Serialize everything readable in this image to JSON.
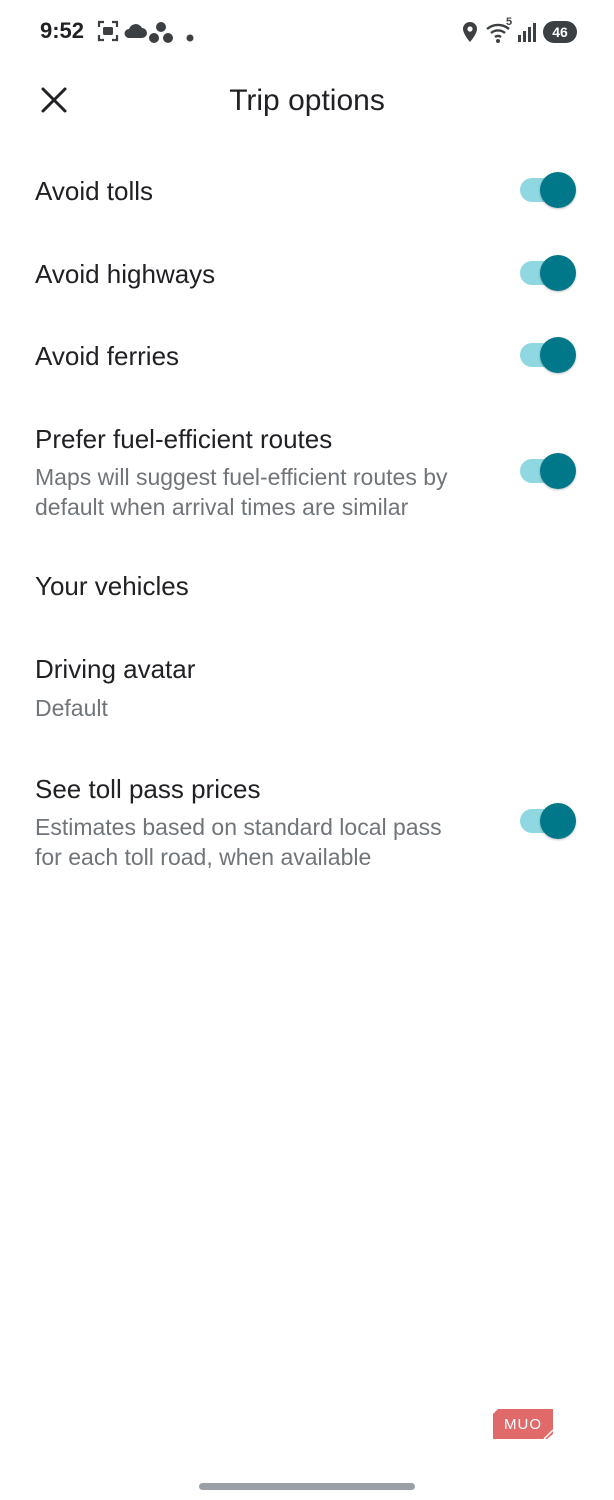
{
  "status_bar": {
    "time": "9:52",
    "icons": [
      "screenshot-icon",
      "cloud-icon",
      "cluster-icon",
      "dot-icon",
      "location-icon",
      "wifi-icon",
      "signal-icon"
    ],
    "wifi_badge": "5",
    "battery_level": "46"
  },
  "header": {
    "title": "Trip options",
    "close_icon": "close-icon"
  },
  "colors": {
    "toggle_thumb": "#00788a",
    "toggle_track": "#8fd7e1",
    "primary_text": "#202124",
    "secondary_text": "#70757a",
    "watermark": "#e06a6a"
  },
  "options": {
    "avoid_tolls": {
      "label": "Avoid tolls",
      "enabled": true
    },
    "avoid_highways": {
      "label": "Avoid highways",
      "enabled": true
    },
    "avoid_ferries": {
      "label": "Avoid ferries",
      "enabled": true
    },
    "fuel_efficient": {
      "label": "Prefer fuel-efficient routes",
      "line1": "Maps will suggest fuel-efficient routes by",
      "line2": "default when arrival times are similar",
      "enabled": true
    },
    "vehicles": {
      "label": "Your vehicles"
    },
    "driving_avatar": {
      "label": "Driving avatar",
      "value": "Default"
    },
    "toll_pass": {
      "label": "See toll pass prices",
      "line1": "Estimates based on standard local pass",
      "line2": "for each toll road, when available",
      "enabled": true
    }
  },
  "watermark": {
    "text": "MUO"
  }
}
